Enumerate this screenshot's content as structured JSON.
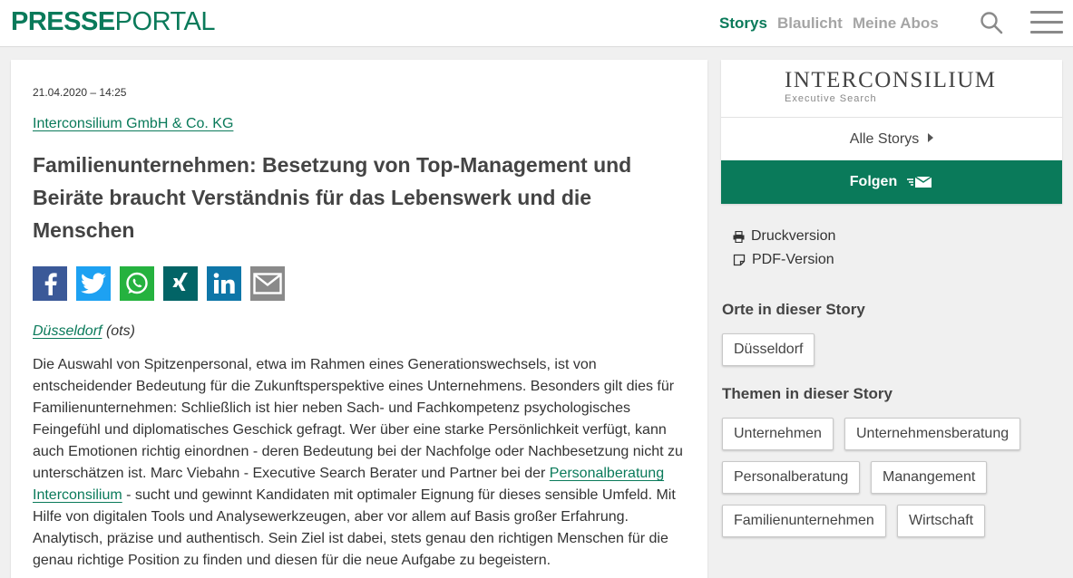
{
  "header": {
    "logo_bold": "PRESSE",
    "logo_light": "PORTAL",
    "nav": [
      "Storys",
      "Blaulicht",
      "Meine Abos"
    ]
  },
  "article": {
    "datetime": "21.04.2020 – 14:25",
    "company": "Interconsilium GmbH & Co. KG",
    "headline": "Familienunternehmen: Besetzung von Top-Management und Beiräte braucht Verständnis für das Lebenswerk und die Menschen",
    "share_icons": [
      "facebook-icon",
      "twitter-icon",
      "whatsapp-icon",
      "xing-icon",
      "linkedin-icon",
      "email-icon"
    ],
    "dateline_place": "Düsseldorf",
    "dateline_source": "(ots)",
    "body_part1": "Die Auswahl von Spitzenpersonal, etwa im Rahmen eines Generationswechsels, ist von entscheidender Bedeutung für die Zukunftsperspektive eines Unternehmens. Besonders gilt dies für Familienunternehmen: Schließlich ist hier neben Sach- und Fachkompetenz psychologisches Feingefühl und diplomatisches Geschick gefragt. Wer über eine starke Persönlichkeit verfügt, kann auch Emotionen richtig einordnen - deren Bedeutung bei der Nachfolge oder Nachbesetzung nicht zu unterschätzen ist. Marc Viebahn - Executive Search Berater und Partner bei der ",
    "body_link": "Personalberatung Interconsilium",
    "body_part2": " - sucht und gewinnt Kandidaten mit optimaler Eignung für dieses sensible Umfeld. Mit Hilfe von digitalen Tools und Analysewerkzeugen, aber vor allem auf Basis großer Erfahrung. Analytisch, präzise und authentisch. Sein Ziel ist dabei, stets genau den richtigen Menschen für die genau richtige Position zu finden und diesen für die neue Aufgabe zu begeistern."
  },
  "sidebar": {
    "brand_name": "INTERCONSILIUM",
    "brand_sub": "Executive Search",
    "all_storys": "Alle Storys",
    "follow": "Folgen",
    "print": "Druckversion",
    "pdf": "PDF-Version",
    "places_heading": "Orte in dieser Story",
    "places": [
      "Düsseldorf"
    ],
    "topics_heading": "Themen in dieser Story",
    "topics": [
      "Unternehmen",
      "Unternehmensberatung",
      "Personalberatung",
      "Manangement",
      "Familienunternehmen",
      "Wirtschaft"
    ]
  },
  "colors": {
    "brand_green": "#0a7a5a",
    "facebook": "#3b5998",
    "twitter": "#1da1f2",
    "whatsapp": "#25b23f",
    "xing": "#026466",
    "linkedin": "#0e76a8",
    "email": "#8a8a8a"
  }
}
